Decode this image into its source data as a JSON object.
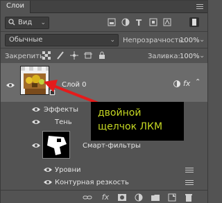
{
  "panel": {
    "tab_label": "Слои"
  },
  "filter": {
    "kind_label": "Вид"
  },
  "blend": {
    "mode_value": "Обычные",
    "opacity_label": "Непрозрачность:",
    "opacity_value": "100%"
  },
  "lock": {
    "lock_label": "Закрепить:",
    "fill_label": "Заливка:",
    "fill_value": "100%"
  },
  "layers": {
    "layer_name": "Слой 0",
    "fx_label": "fx",
    "effects_label": "Эффекты",
    "shadow_label": "Тень",
    "smart_filters_label": "Смарт-фильтры",
    "levels_label": "Уровни",
    "sharpen_label": "Контурная резкость"
  },
  "annotation": {
    "line1": "двойной",
    "line2": "щелчок ЛКМ",
    "color": "#c6d823",
    "arrow_color": "#e41b1b"
  },
  "toolbar": {
    "fx_label": "fx"
  }
}
